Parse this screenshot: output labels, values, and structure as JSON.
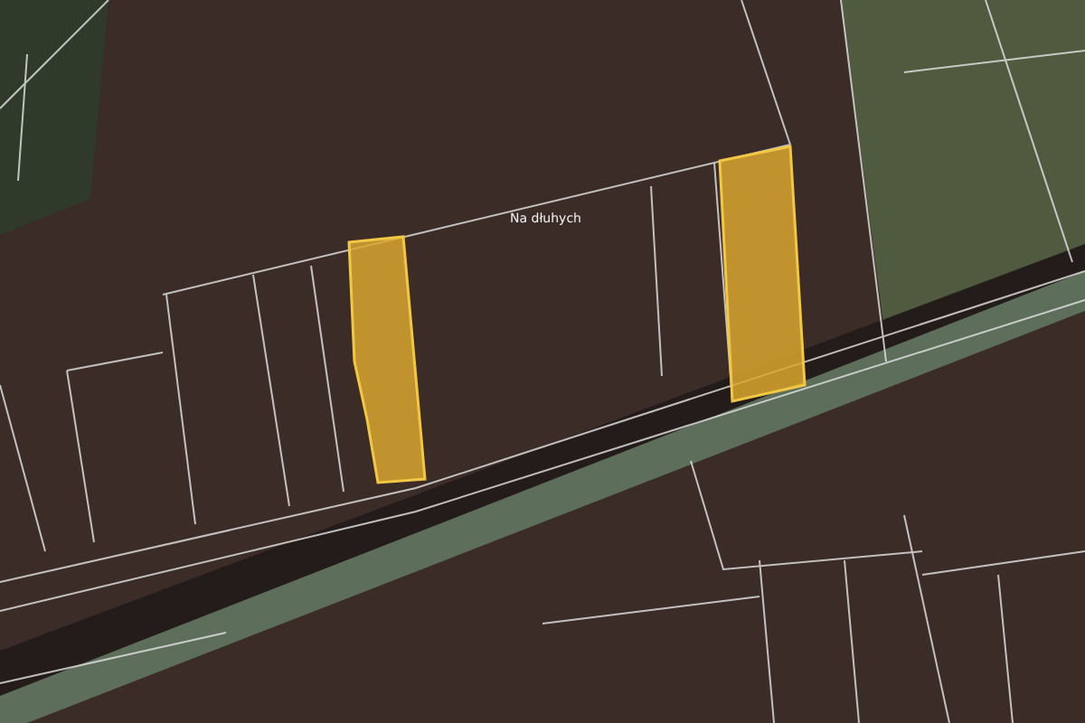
{
  "map": {
    "labels": [
      {
        "text": "Na dłuhych"
      }
    ]
  }
}
